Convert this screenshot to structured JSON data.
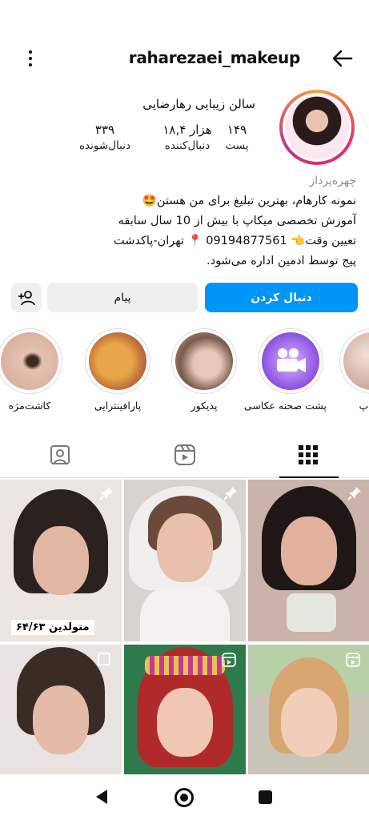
{
  "profile": {
    "username": "raharezaei_makeup",
    "full_name": "سالن زیبایی رهارضایی",
    "posts_count": "۱۴۹",
    "posts_label": "پست",
    "followers_count": "۱۸,۴ هزار",
    "followers_label": "دنبال‌کننده",
    "following_count": "۳۳۹",
    "following_label": "دنبال‌شونده"
  },
  "bio": {
    "category": "چهره‌پرداز",
    "line1": "نمونه کارهام، بهترین تبلیغ برای من هستن🤩",
    "line2": "آموزش تخصصی میکاپ با بیش از 10 سال سابقه",
    "line3": "تعیین وقت👈 09194877561 📍 تهران-پاکدشت",
    "line4": "پیج توسط ادمین اداره می‌شود."
  },
  "actions": {
    "follow_label": "دنبال کردن",
    "message_label": "پیام"
  },
  "highlights": [
    {
      "label": "میکاپ",
      "color": "#e9d8cf"
    },
    {
      "label": "پشت صحنه عکاسی",
      "color": "#8a4fe0"
    },
    {
      "label": "پدیکور",
      "color": "#c9a895"
    },
    {
      "label": "پارافینترایی",
      "color": "#d89a4a"
    },
    {
      "label": "کاشت‌مژه",
      "color": "#d8b6a6"
    }
  ],
  "grid": {
    "caption_tag": "متولدین ۶۴/۶۳"
  },
  "icons": {
    "back": "arrow-left-icon",
    "menu": "vertical-dots-icon",
    "add_user": "add-user-icon",
    "grid_tab": "grid-icon",
    "reels_tab": "reels-icon",
    "tagged_tab": "tagged-icon",
    "pin": "pin-icon",
    "reel": "reel-icon"
  },
  "colors": {
    "accent": "#0095f6",
    "button_bg": "#efefef"
  }
}
